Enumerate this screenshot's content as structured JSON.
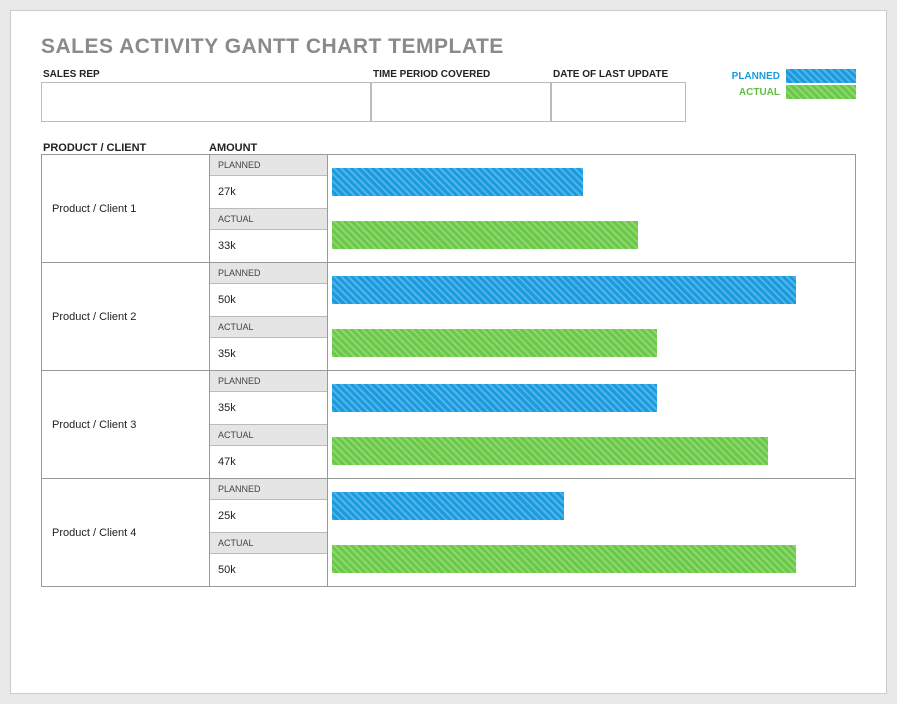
{
  "title": "SALES ACTIVITY GANTT CHART TEMPLATE",
  "fields": {
    "sales_rep_label": "SALES REP",
    "sales_rep_value": "",
    "time_period_label": "TIME PERIOD COVERED",
    "time_period_value": "",
    "last_update_label": "DATE OF LAST UPDATE",
    "last_update_value": ""
  },
  "legend": {
    "planned": "PLANNED",
    "actual": "ACTUAL"
  },
  "columns": {
    "product": "PRODUCT / CLIENT",
    "amount": "AMOUNT"
  },
  "sublabels": {
    "planned": "PLANNED",
    "actual": "ACTUAL"
  },
  "products": [
    {
      "name": "Product / Client 1",
      "planned_label": "27k",
      "actual_label": "33k"
    },
    {
      "name": "Product / Client 2",
      "planned_label": "50k",
      "actual_label": "35k"
    },
    {
      "name": "Product / Client 3",
      "planned_label": "35k",
      "actual_label": "47k"
    },
    {
      "name": "Product / Client 4",
      "planned_label": "25k",
      "actual_label": "50k"
    }
  ],
  "chart_data": {
    "type": "bar",
    "title": "SALES ACTIVITY GANTT CHART TEMPLATE",
    "xlabel": "",
    "ylabel": "AMOUNT (k)",
    "categories": [
      "Product / Client 1",
      "Product / Client 2",
      "Product / Client 3",
      "Product / Client 4"
    ],
    "series": [
      {
        "name": "PLANNED",
        "values": [
          27,
          50,
          35,
          25
        ],
        "color": "#1a9be0"
      },
      {
        "name": "ACTUAL",
        "values": [
          33,
          35,
          47,
          50
        ],
        "color": "#6ac946"
      }
    ],
    "xlim": [
      0,
      56
    ]
  }
}
